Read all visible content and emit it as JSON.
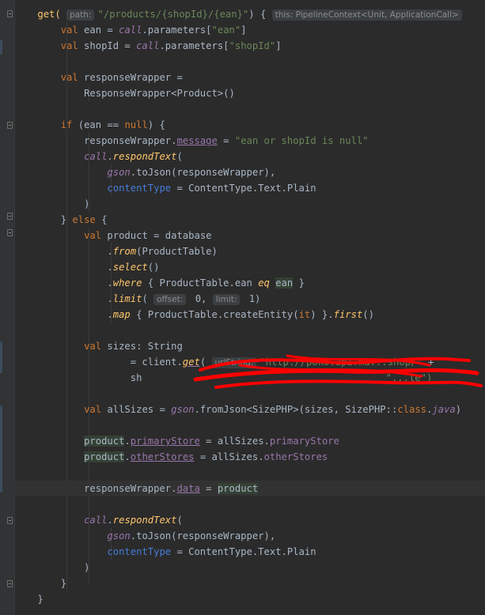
{
  "code": {
    "l1_get": "get(",
    "l1_hint_path": "path:",
    "l1_str": "\"/products/{shopId}/{ean}\"",
    "l1_brace": ") {",
    "l1_hint_this": "this: PipelineContext<Unit, ApplicationCall>",
    "l2_val": "val",
    "l2_name": " ean = ",
    "l2_call": "call",
    "l2_params": ".parameters[",
    "l2_str": "\"ean\"",
    "l2_end": "]",
    "l3_name": " shopId = ",
    "l3_str": "\"shopId\"",
    "l5_name": " responseWrapper =",
    "l6_text": "ResponseWrapper<Product>()",
    "l8_if": "if",
    "l8_cond": " (ean == ",
    "l8_null": "null",
    "l8_end": ") {",
    "l9_a": "responseWrapper.",
    "l9_prop": "message",
    "l9_b": " = ",
    "l9_str": "\"ean or shopId is null\"",
    "l10_fn": "respondText",
    "l10_b": "(",
    "l11_gson": "gson",
    "l11_rest": ".toJson(responseWrapper),",
    "l12_named": "contentType",
    "l12_rest": " = ContentType.Text.Plain",
    "l13": ")",
    "l14_a": "} ",
    "l14_else": "else",
    "l14_b": " {",
    "l15_name": " product",
    "l15_rest": " = database",
    "l16_dot": ".",
    "l16_fn": "from",
    "l16_rest": "(ProductTable)",
    "l17_fn": "select",
    "l17_rest": "()",
    "l18_fn": "where",
    "l18_rest": " { ProductTable.ean ",
    "l18_eq": "eq",
    "l18_ean": "ean",
    "l18_end": " }",
    "l19_fn": "limit",
    "l19_hint1": "offset:",
    "l19_v1": " 0, ",
    "l19_hint2": "limit:",
    "l19_v2": " 1)",
    "l20_fn": "map",
    "l20_rest": " { ProductTable.createEntity(",
    "l20_it": "it",
    "l20_rest2": ") }.",
    "l20_first": "first",
    "l20_end": "()",
    "l22_name": " sizes: String",
    "l23_a": "= client.",
    "l23_fn": "get",
    "l23_b": "(",
    "l23_hint": "urlString:",
    "l23_str": "\"http://poko.api.ma...shop/\"",
    "l23_end": " +",
    "l24_a": "sh",
    "l24_str": "\"...le\")",
    "l26_name": " allSizes = ",
    "l26_gson": "gson",
    "l26_rest": ".fromJson<SizePHP>(sizes, SizePHP::",
    "l26_class": "class",
    "l26_dot": ".",
    "l26_java": "java",
    "l26_end": ")",
    "l28_a": "product",
    "l28_dot": ".",
    "l28_prop": "primaryStore",
    "l28_b": " = allSizes.",
    "l28_prop2": "primaryStore",
    "l29_prop": "otherStores",
    "l29_prop2": "otherStores",
    "l31_a": "responseWrapper.",
    "l31_prop": "data",
    "l31_b": " = ",
    "l31_c": "product",
    "l33_call": "call",
    "l33_dot": ".",
    "l33_fn": "respondText",
    "l33_b": "(",
    "l37": "}",
    "l38": "}"
  },
  "colors": {
    "background": "#2b2b2b",
    "keyword": "#cc7832",
    "string": "#6a8759",
    "function": "#ffc66d",
    "property": "#9876aa",
    "named_arg": "#467cda",
    "text": "#a9b7c6",
    "redaction": "#ff0000"
  }
}
